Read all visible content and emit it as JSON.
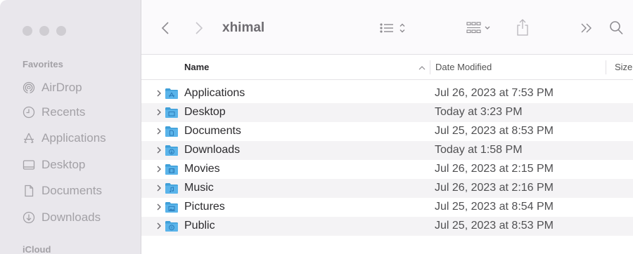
{
  "toolbar": {
    "title": "xhimal",
    "icons": [
      "back-chevron-icon",
      "forward-chevron-icon",
      "list-view-icon",
      "group-view-icon",
      "share-icon",
      "more-toolbar-icon",
      "search-icon"
    ]
  },
  "sidebar": {
    "favorites_label": "Favorites",
    "items": [
      {
        "label": "AirDrop",
        "icon": "airdrop-icon"
      },
      {
        "label": "Recents",
        "icon": "clock-icon"
      },
      {
        "label": "Applications",
        "icon": "applications-icon"
      },
      {
        "label": "Desktop",
        "icon": "desktop-icon"
      },
      {
        "label": "Documents",
        "icon": "document-icon"
      },
      {
        "label": "Downloads",
        "icon": "download-icon"
      }
    ],
    "icloud_label": "iCloud"
  },
  "columns": {
    "name": "Name",
    "date": "Date Modified",
    "size": "Size"
  },
  "files": [
    {
      "name": "Applications",
      "date": "Jul 26, 2023 at 7:53 PM",
      "icon": "applications-folder-icon"
    },
    {
      "name": "Desktop",
      "date": "Today at 3:23 PM",
      "icon": "desktop-folder-icon"
    },
    {
      "name": "Documents",
      "date": "Jul 25, 2023 at 8:53 PM",
      "icon": "documents-folder-icon"
    },
    {
      "name": "Downloads",
      "date": "Today at 1:58 PM",
      "icon": "downloads-folder-icon"
    },
    {
      "name": "Movies",
      "date": "Jul 26, 2023 at 2:15 PM",
      "icon": "movies-folder-icon"
    },
    {
      "name": "Music",
      "date": "Jul 26, 2023 at 2:16 PM",
      "icon": "music-folder-icon"
    },
    {
      "name": "Pictures",
      "date": "Jul 25, 2023 at 8:54 PM",
      "icon": "pictures-folder-icon"
    },
    {
      "name": "Public",
      "date": "Jul 25, 2023 at 8:53 PM",
      "icon": "public-folder-icon"
    }
  ],
  "colors": {
    "folder": "#5ab4ea",
    "sidebar_bg": "#e9e7ec",
    "sidebar_text": "#a3a1a6"
  }
}
